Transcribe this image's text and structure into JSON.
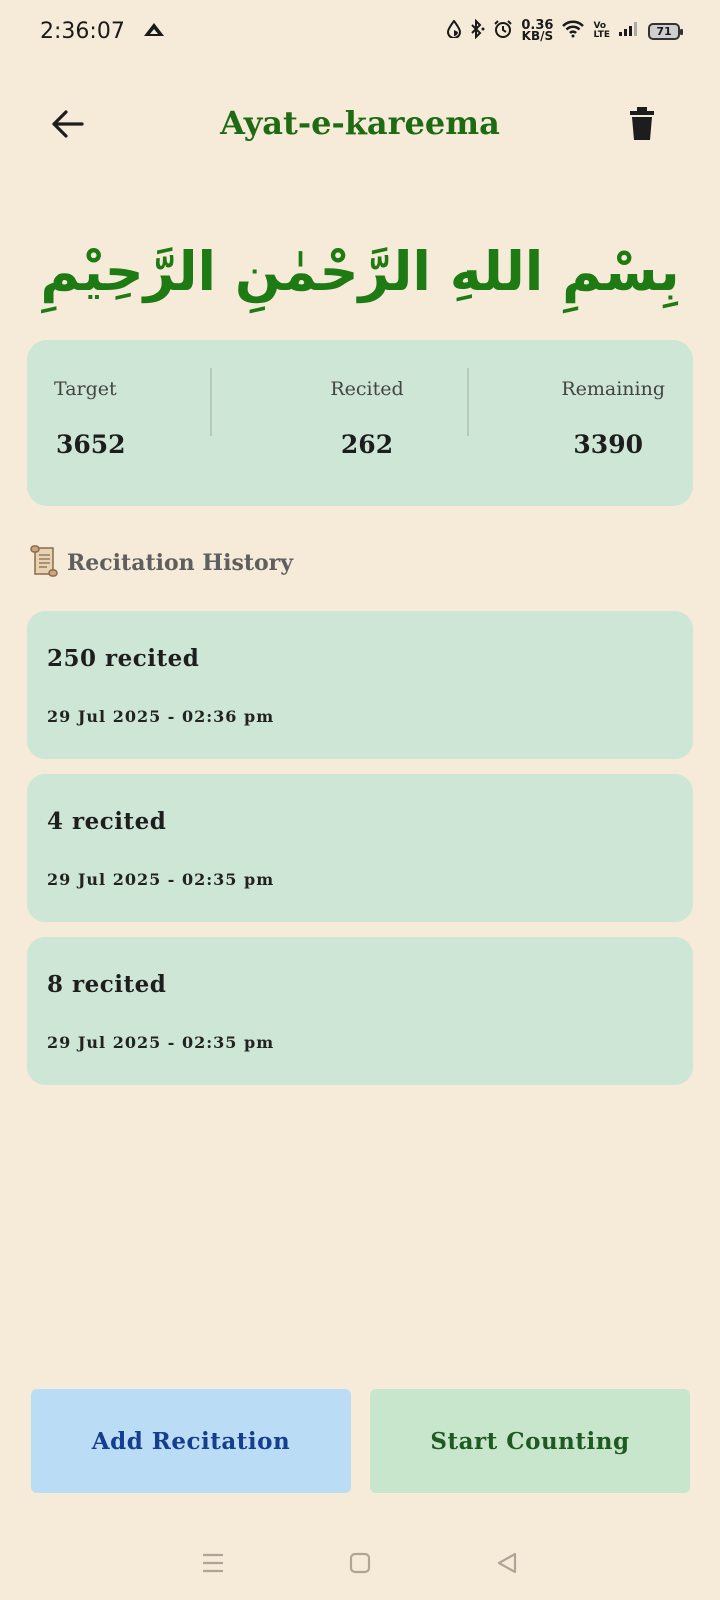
{
  "status_bar": {
    "time": "2:36:07",
    "net_speed_value": "0.36",
    "net_speed_unit": "KB/S",
    "volte_top": "Vo",
    "volte_bottom": "LTE",
    "battery": "71"
  },
  "app_bar": {
    "title": "Ayat-e-kareema",
    "back_icon": "arrow-left-icon",
    "delete_icon": "trash-icon"
  },
  "bismillah": "بِسْمِ اللهِ الرَّحْمٰنِ الرَّحِيْمِ",
  "stats": {
    "target_label": "Target",
    "target_value": "3652",
    "recited_label": "Recited",
    "recited_value": "262",
    "remaining_label": "Remaining",
    "remaining_value": "3390"
  },
  "history": {
    "icon": "scroll-icon",
    "title": "Recitation History",
    "items": [
      {
        "count": "250 recited",
        "date": "29 Jul 2025 - 02:36 pm"
      },
      {
        "count": "4 recited",
        "date": "29 Jul 2025 - 02:35 pm"
      },
      {
        "count": "8 recited",
        "date": "29 Jul 2025 - 02:35 pm"
      }
    ]
  },
  "actions": {
    "add_label": "Add Recitation",
    "start_label": "Start Counting"
  },
  "colors": {
    "background": "#f6ebd9",
    "card": "#cde6d5",
    "title_green": "#1e6b14",
    "add_button": "#bbdcf5",
    "start_button": "#c8e6cc"
  }
}
